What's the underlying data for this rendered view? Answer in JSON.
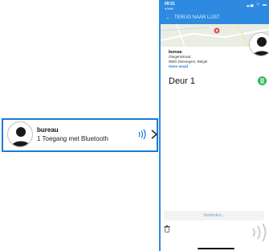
{
  "card": {
    "name": "bureau",
    "subtitle": "1 Toegang met Bluetooth"
  },
  "phone": {
    "status": {
      "time": "09:51",
      "carrier": "◂ Mail",
      "icons": "▂▄ ⌔ ▬"
    },
    "nav": {
      "back_label": "TERUG NAAR LIJST"
    },
    "info": {
      "name": "bureau",
      "street": "Otegemstraat",
      "city": "8550 Zwevegem, België",
      "email": "Geen email"
    },
    "door": {
      "label": "Deur 1"
    },
    "connect_label": "Verbinden..."
  },
  "colors": {
    "accent": "#2d8ae0",
    "card_border": "#1e7bd6",
    "badge": "#2fb55a"
  }
}
